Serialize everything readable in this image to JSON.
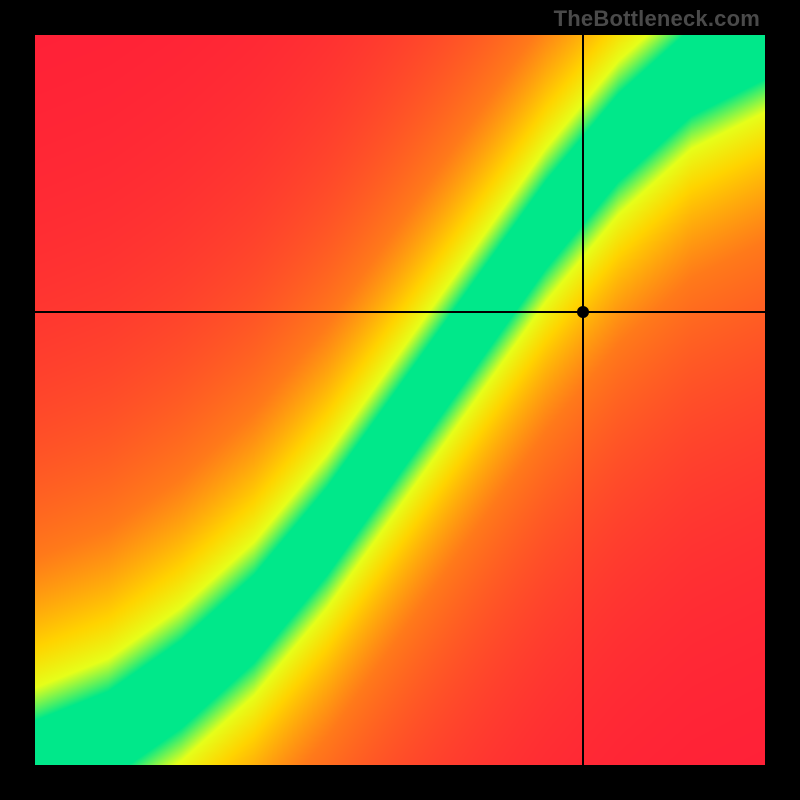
{
  "watermark": "TheBottleneck.com",
  "chart_data": {
    "type": "heatmap",
    "title": "",
    "xlabel": "",
    "ylabel": "",
    "xlim": [
      0,
      100
    ],
    "ylim": [
      0,
      100
    ],
    "crosshair": {
      "x": 75,
      "y": 62
    },
    "marker": {
      "x": 75,
      "y": 62
    },
    "ridge": {
      "description": "Green optimal band running from bottom-left to top-right, curving upward; surrounded by yellow/orange/red gradient (red = worst, green = best).",
      "points": [
        {
          "x": 0,
          "y": 0
        },
        {
          "x": 10,
          "y": 4
        },
        {
          "x": 20,
          "y": 11
        },
        {
          "x": 30,
          "y": 20
        },
        {
          "x": 40,
          "y": 32
        },
        {
          "x": 50,
          "y": 46
        },
        {
          "x": 60,
          "y": 60
        },
        {
          "x": 70,
          "y": 74
        },
        {
          "x": 80,
          "y": 86
        },
        {
          "x": 90,
          "y": 95
        },
        {
          "x": 100,
          "y": 100
        }
      ],
      "band_halfwidth_pct": 6
    },
    "color_scale": [
      {
        "value": 0.0,
        "color": "#ff1a3a"
      },
      {
        "value": 0.45,
        "color": "#ff7a1a"
      },
      {
        "value": 0.7,
        "color": "#ffd400"
      },
      {
        "value": 0.85,
        "color": "#e6ff1a"
      },
      {
        "value": 1.0,
        "color": "#00e88a"
      }
    ]
  }
}
